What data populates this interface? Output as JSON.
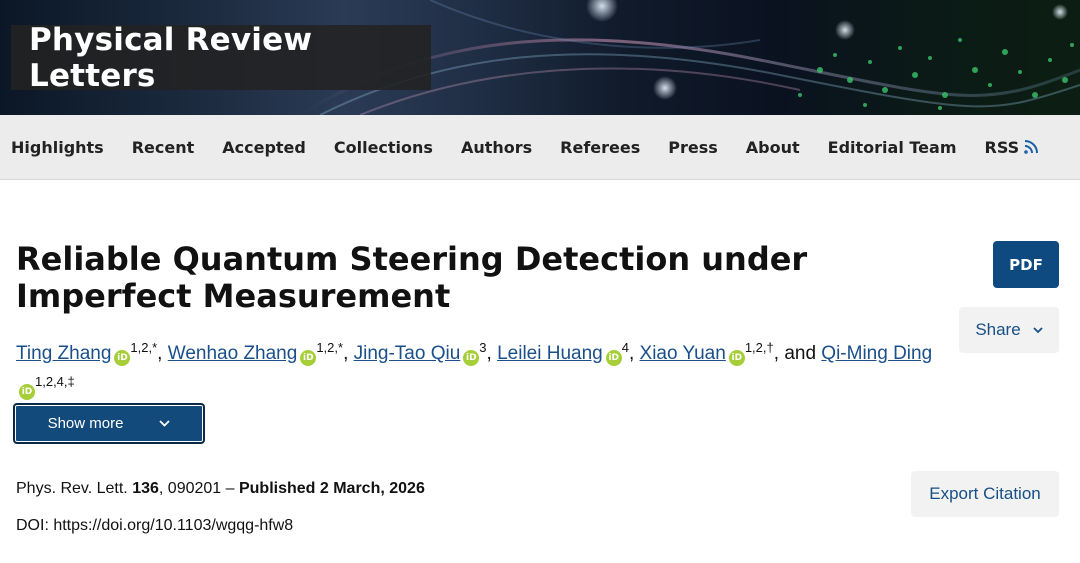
{
  "header": {
    "journal_title": "Physical Review Letters"
  },
  "nav": {
    "items": [
      "Highlights",
      "Recent",
      "Accepted",
      "Collections",
      "Authors",
      "Referees",
      "Press",
      "About",
      "Editorial Team",
      "RSS"
    ]
  },
  "article": {
    "title": "Reliable Quantum Steering Detection under Imperfect Measurement",
    "pdf_label": "PDF",
    "share_label": "Share",
    "show_more_label": "Show more",
    "export_label": "Export Citation",
    "authors": [
      {
        "name": "Ting Zhang",
        "aff": "1,2,*"
      },
      {
        "name": "Wenhao Zhang",
        "aff": "1,2,*"
      },
      {
        "name": "Jing-Tao Qiu",
        "aff": "3"
      },
      {
        "name": "Leilei Huang",
        "aff": "4"
      },
      {
        "name": "Xiao Yuan",
        "aff": "1,2,†"
      },
      {
        "name": "Qi-Ming Ding",
        "aff": "1,2,4,‡"
      }
    ],
    "and_text": "and",
    "orcid_text": "iD",
    "citation": {
      "journal": "Phys. Rev. Lett.",
      "volume": "136",
      "article_number": ", 090201 – ",
      "published": "Published 2 March, 2026"
    },
    "doi": "DOI: https://doi.org/10.1103/wgqg-hfw8"
  },
  "icons": {
    "rss": "rss-icon",
    "share": "chevron-down-icon",
    "show_more": "chevron-down-icon",
    "orcid": "orcid-icon"
  },
  "colors": {
    "nav_bg": "#ececec",
    "primary_button": "#0e4a80",
    "link": "#1a4f8a",
    "orcid": "#a6ce39"
  }
}
